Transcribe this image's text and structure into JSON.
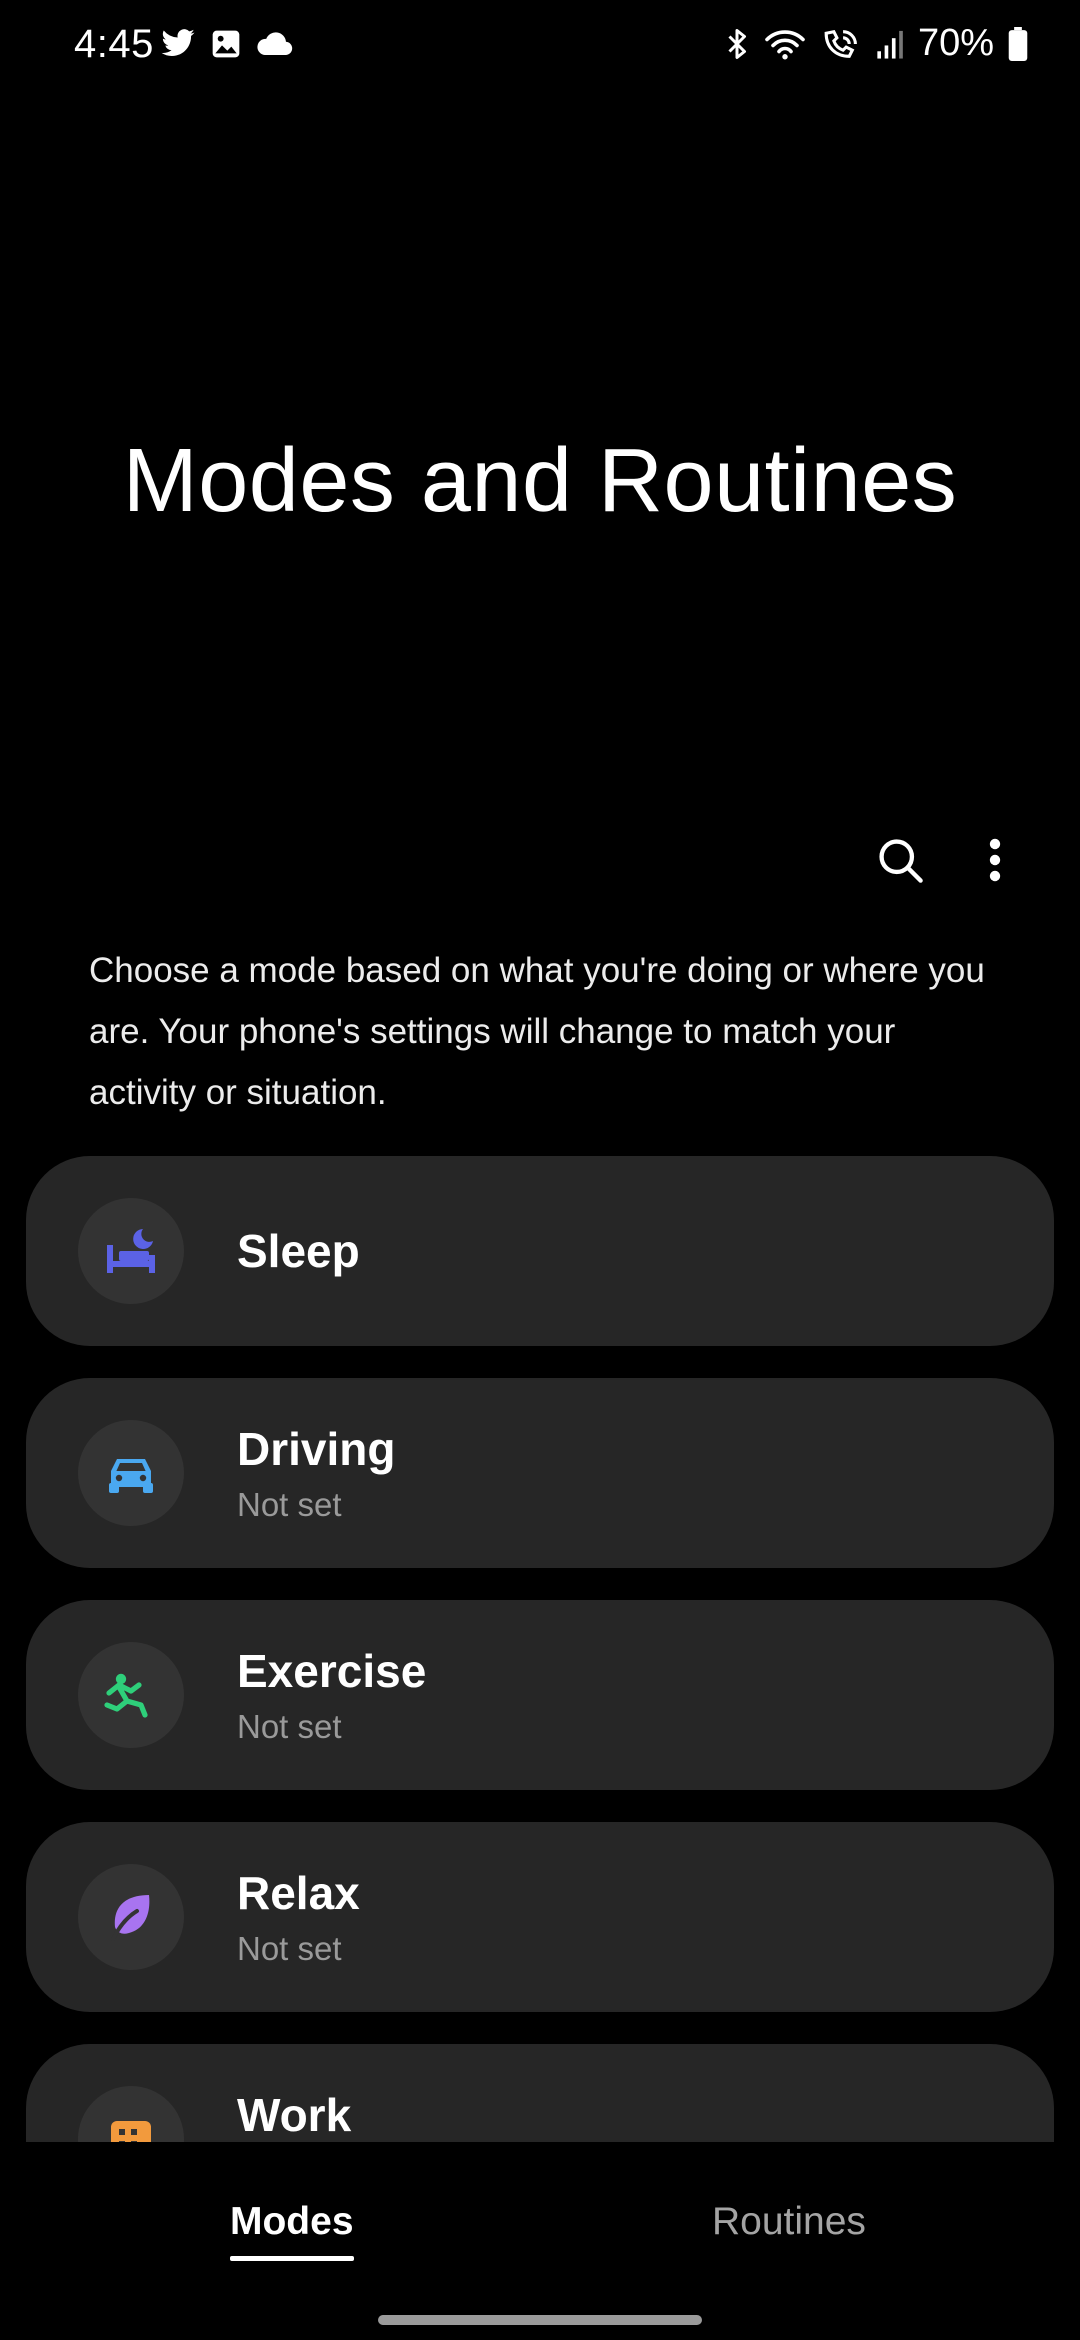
{
  "status_bar": {
    "time": "4:45",
    "left_icons": [
      "twitter-icon",
      "gallery-icon",
      "cloud-icon"
    ],
    "right_icons": [
      "bluetooth-icon",
      "wifi-icon",
      "wifi-calling-icon",
      "signal-icon",
      "battery-icon"
    ],
    "battery": "70%"
  },
  "header": {
    "title": "Modes and Routines"
  },
  "toolbar": {
    "search_icon": "search-icon",
    "more_icon": "more-options-icon"
  },
  "description": "Choose a mode based on what you're doing or where you are. Your phone's settings will change to match your activity or situation.",
  "modes": [
    {
      "label": "Sleep",
      "status": "",
      "icon": "bed-moon-icon",
      "color": "#5b62e6"
    },
    {
      "label": "Driving",
      "status": "Not set",
      "icon": "car-icon",
      "color": "#4aa8f0"
    },
    {
      "label": "Exercise",
      "status": "Not set",
      "icon": "running-icon",
      "color": "#2ecf7a"
    },
    {
      "label": "Relax",
      "status": "Not set",
      "icon": "leaf-icon",
      "color": "#a874f0"
    },
    {
      "label": "Work",
      "status": "",
      "icon": "building-icon",
      "color": "#f29a3d"
    }
  ],
  "bottom_tabs": {
    "modes": "Modes",
    "routines": "Routines",
    "selected": "Modes"
  },
  "colors": {
    "background": "#000000",
    "card": "#262626",
    "icon_circle": "#333333",
    "secondary_text": "#9a9a9a"
  }
}
